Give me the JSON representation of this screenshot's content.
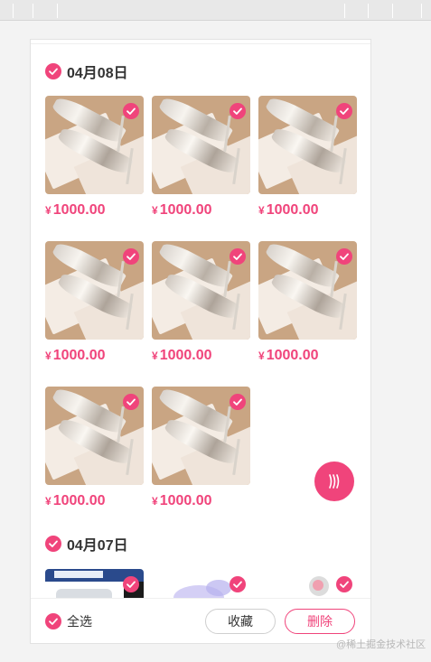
{
  "colors": {
    "accent": "#f0447b",
    "text": "#333333"
  },
  "sections": [
    {
      "title": "04月08日",
      "items": [
        {
          "price": "1000.00",
          "currency": "¥"
        },
        {
          "price": "1000.00",
          "currency": "¥"
        },
        {
          "price": "1000.00",
          "currency": "¥"
        },
        {
          "price": "1000.00",
          "currency": "¥"
        },
        {
          "price": "1000.00",
          "currency": "¥"
        },
        {
          "price": "1000.00",
          "currency": "¥"
        },
        {
          "price": "1000.00",
          "currency": "¥"
        },
        {
          "price": "1000.00",
          "currency": "¥"
        }
      ]
    },
    {
      "title": "04月07日"
    }
  ],
  "bottom_bar": {
    "select_all_label": "全选",
    "collect_label": "收藏",
    "delete_label": "删除"
  },
  "watermark": "@稀土掘金技术社区",
  "icons": {
    "check": "check-circle-icon",
    "fab": "wave-lines-icon"
  }
}
